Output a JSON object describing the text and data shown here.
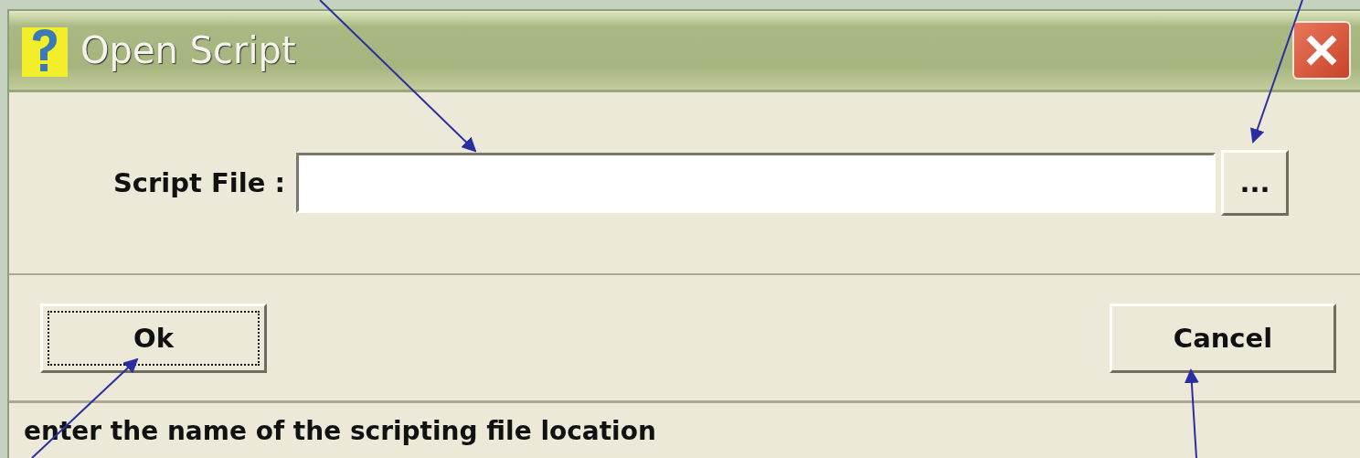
{
  "window": {
    "title": "Open Script"
  },
  "field": {
    "label": "Script File :",
    "browse_label": "..."
  },
  "buttons": [
    {
      "label": "Ok",
      "focused": true
    },
    {
      "label": "Cancel",
      "focused": false
    }
  ],
  "status_bar": {
    "text": "enter the name of the scripting file location"
  }
}
